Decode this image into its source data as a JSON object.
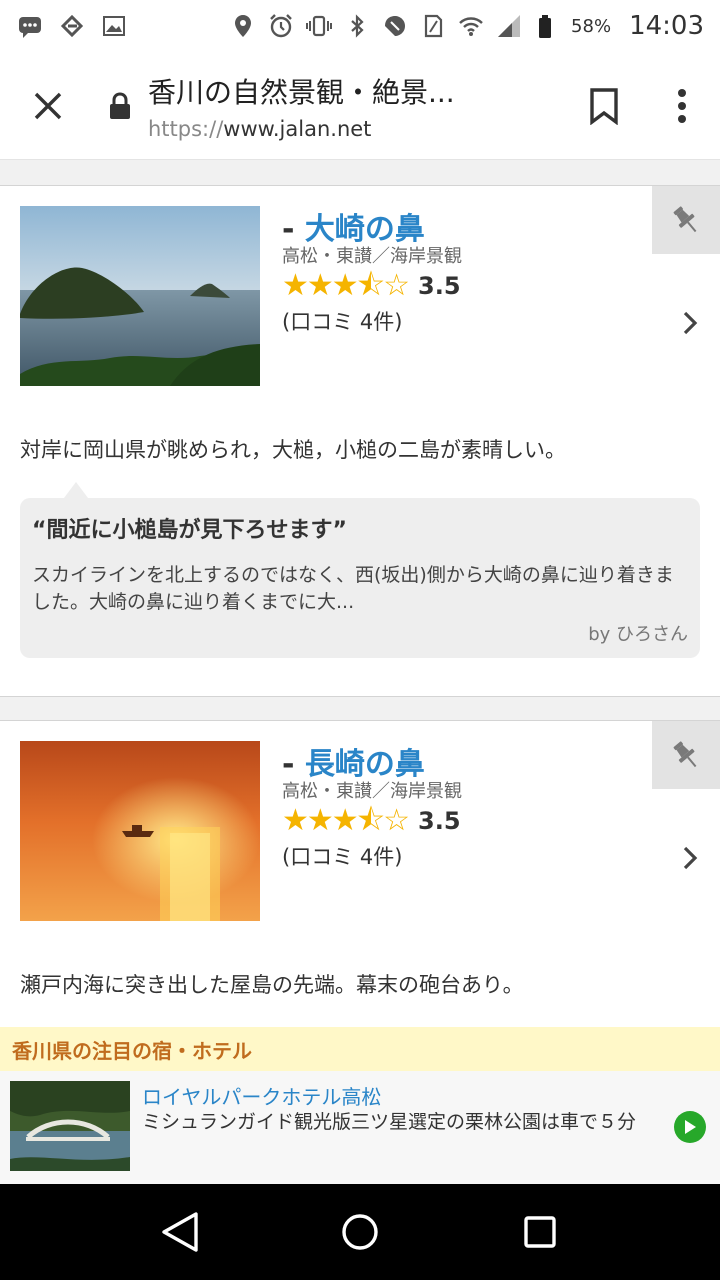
{
  "status_bar": {
    "battery_percent": "58%",
    "time": "14:03",
    "icons": [
      "chat-icon",
      "edge-icon",
      "image-icon",
      "location-icon",
      "alarm-icon",
      "vibrate-icon",
      "bluetooth-icon",
      "nfc-icon",
      "sim-icon",
      "wifi-icon",
      "signal-icon",
      "battery-icon"
    ]
  },
  "browser": {
    "title": "香川の自然景観・絶景...",
    "url_scheme": "https://",
    "url_host": "www.jalan.net"
  },
  "spots": [
    {
      "dash": "-",
      "name": "大崎の鼻",
      "area": "高松・東讃／海岸景観",
      "stars": "★★★⯪☆",
      "rating": 3.5,
      "score": "3.5",
      "reviews": "(口コミ 4件)",
      "description": "対岸に岡山県が眺められ，大槌，小槌の二島が素晴しい。",
      "review": {
        "title": "“間近に小槌島が見下ろせます”",
        "body": "スカイラインを北上するのではなく、西(坂出)側から大崎の鼻に辿り着きました。大崎の鼻に辿り着くまでに大...",
        "by": "by ひろさん"
      }
    },
    {
      "dash": "-",
      "name": "長崎の鼻",
      "area": "高松・東讃／海岸景観",
      "stars": "★★★⯪☆",
      "rating": 3.5,
      "score": "3.5",
      "reviews": "(口コミ 4件)",
      "description": "瀬戸内海に突き出した屋島の先端。幕末の砲台あり。"
    }
  ],
  "ad": {
    "header": "香川県の注目の宿・ホテル",
    "title": "ロイヤルパークホテル高松",
    "text": "ミシュランガイド観光版三ツ星選定の栗林公園は車で５分"
  },
  "colors": {
    "link_blue": "#2a85c8",
    "star_gold": "#f5b400",
    "ad_header_bg": "#fff8c8",
    "ad_header_text": "#c06c1e",
    "play_green": "#27a82a"
  }
}
